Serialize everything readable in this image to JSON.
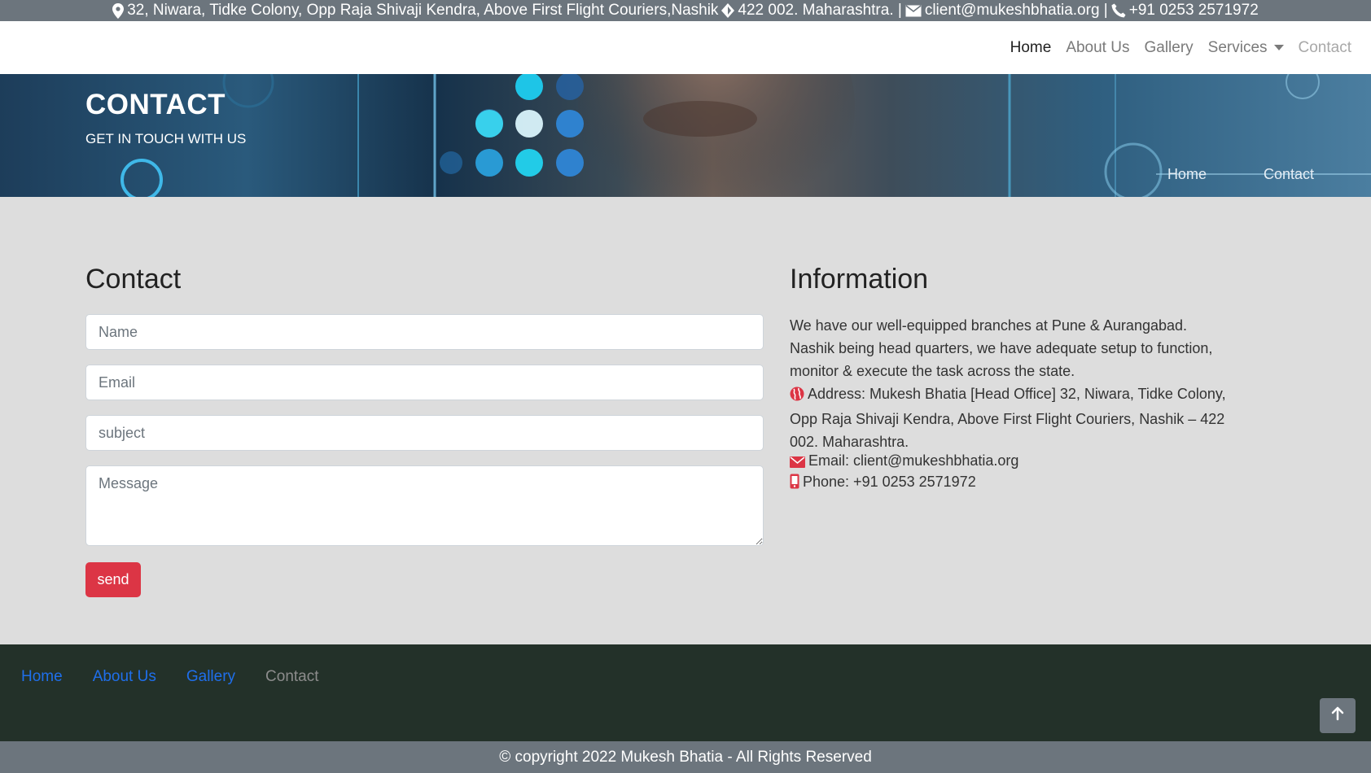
{
  "topbar": {
    "address": "32, Niwara, Tidke Colony, Opp Raja Shivaji Kendra, Above First Flight Couriers,Nashik",
    "pincode": "422 002. Maharashtra. |",
    "email": "client@mukeshbhatia.org |",
    "phone": "+91 0253 2571972"
  },
  "nav": {
    "items": [
      {
        "label": "Home"
      },
      {
        "label": "About Us"
      },
      {
        "label": "Gallery"
      },
      {
        "label": "Services"
      },
      {
        "label": "Contact"
      }
    ]
  },
  "hero": {
    "title": "CONTACT",
    "subtitle": "GET IN TOUCH WITH US",
    "breadcrumb": [
      "Home",
      "Contact"
    ]
  },
  "contact_form": {
    "heading": "Contact",
    "name_placeholder": "Name",
    "email_placeholder": "Email",
    "subject_placeholder": "subject",
    "message_placeholder": "Message",
    "send_label": "send"
  },
  "information": {
    "heading": "Information",
    "intro": "We have our well-equipped branches at Pune & Aurangabad. Nashik being head quarters, we have adequate setup to function, monitor & execute the task across the state.",
    "address": "Address: Mukesh Bhatia [Head Office] 32, Niwara, Tidke Colony, Opp Raja Shivaji Kendra, Above First Flight Couriers, Nashik – 422 002. Maharashtra.",
    "email": "Email: client@mukeshbhatia.org",
    "phone": "Phone: +91 0253 2571972"
  },
  "footer": {
    "links": [
      "Home",
      "About Us",
      "Gallery",
      "Contact"
    ],
    "copyright": "© copyright 2022 Mukesh Bhatia - All Rights Reserved"
  },
  "icons": {
    "topbar": [
      "map-marker-icon",
      "diamond-icon",
      "envelope-icon",
      "phone-icon"
    ],
    "info": [
      "globe-icon",
      "envelope-icon",
      "mobile-phone-icon"
    ],
    "back_to_top": "arrow-up-icon"
  },
  "colors": {
    "accent_red": "#dc3545",
    "topbar_gray": "#6c757d",
    "footer_dark": "#233129",
    "link_blue": "#1f6feb",
    "main_bg": "#dddddd"
  }
}
